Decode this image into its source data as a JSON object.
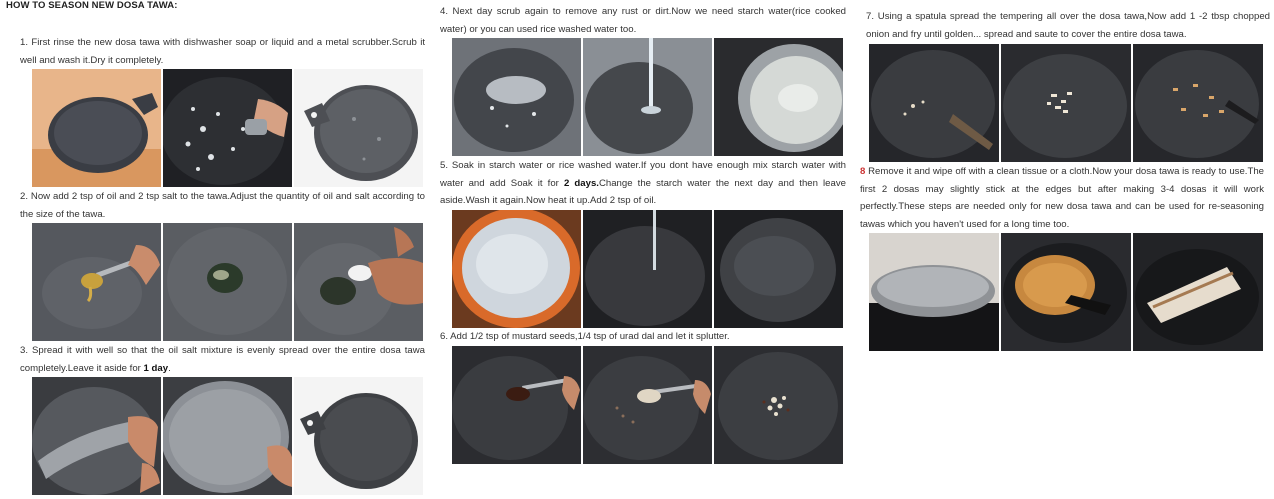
{
  "title": "HOW TO SEASON NEW DOSA TAWA:",
  "steps": [
    {
      "text": "1. First rinse the new dosa tawa with dishwasher soap or liquid and a metal scrubber.Scrub it well and wash it.Dry it completely."
    },
    {
      "text": "2. Now add 2 tsp of oil and 2 tsp salt to the tawa.Adjust the quantity of oil and salt according to the size of the tawa."
    },
    {
      "text_before": "3. Spread it with well so that the oil salt mixture is evenly spread over the entire dosa tawa completely.Leave it aside for ",
      "bold": "1 day",
      "text_after": "."
    },
    {
      "text": "4. Next day scrub again to remove any rust or dirt.Now we need starch water(rice cooked water) or you can used rice washed water too."
    },
    {
      "text_before": "5. Soak in starch water or rice washed water.If you dont have enough mix starch water with water and add Soak it for ",
      "bold": "2 days.",
      "text_after": "Change the starch water the next day and then leave aside.Wash it again.Now heat it up.Add 2 tsp of oil."
    },
    {
      "text": "6. Add 1/2 tsp of mustard seeds,1/4 tsp of urad dal and let it splutter."
    },
    {
      "text": "7. Using a spatula spread the tempering all over the dosa tawa,Now add 1 -2 tbsp chopped onion and fry until golden... spread and saute to cover the entire dosa tawa."
    },
    {
      "num": "8",
      "text": " Remove it and wipe off with a clean tissue or a cloth.Now your dosa tawa is ready to use.The first 2 dosas may slightly stick at the edges but after making 3-4 dosas it will work perfectly.These steps are needed only for new dosa tawa and can be used for re-seasoning tawas which you haven't used for a long time too."
    }
  ],
  "photos": [
    [
      "tawa-on-counter-photo",
      "scrubbing-tawa-photo",
      "clean-tawa-photo"
    ],
    [
      "oil-spoon-photo",
      "oil-puddle-photo",
      "adding-salt-photo"
    ],
    [
      "spreading-salt-photo",
      "salt-covered-tawa-photo",
      "rested-tawa-photo"
    ],
    [
      "scrubbed-tawa-photo",
      "rinsing-tawa-photo",
      "starch-water-photo"
    ],
    [
      "soaking-tawa-photo",
      "heating-tawa-photo",
      "oiled-tawa-photo"
    ],
    [
      "mustard-seeds-photo",
      "urad-dal-photo",
      "spluttering-photo"
    ],
    [
      "tempering-photo",
      "onion-frying-photo",
      "golden-onion-photo"
    ],
    [
      "clean-dosa-tawa-photo",
      "first-dosa-photo",
      "rolled-dosa-photo"
    ]
  ]
}
